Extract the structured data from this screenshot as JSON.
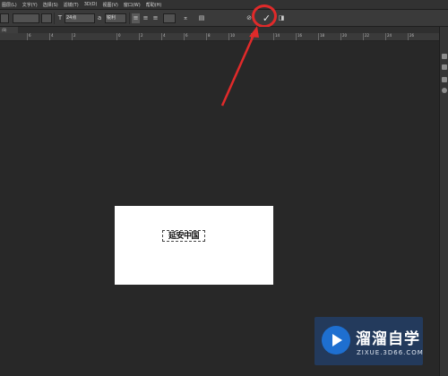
{
  "menubar": {
    "items": [
      "图层(L)",
      "文字(Y)",
      "选择(S)",
      "滤镜(T)",
      "3D(D)",
      "视图(V)",
      "窗口(W)",
      "帮助(H)"
    ]
  },
  "options": {
    "font_size": "24点",
    "antialias": "锐利",
    "icons": [
      "text-orientation-icon",
      "align-left-icon",
      "align-center-icon",
      "align-right-icon",
      "warp-text-icon",
      "character-panel-icon",
      "cancel-icon",
      "commit-icon",
      "3d-icon"
    ],
    "commit_glyph": "✓",
    "cancel_glyph": "⊘"
  },
  "tabs": [
    "/8)"
  ],
  "ruler": {
    "ticks": [
      "6",
      "4",
      "2",
      "0",
      "2",
      "4",
      "6",
      "8",
      "10",
      "12",
      "14",
      "16",
      "18",
      "20",
      "22",
      "24",
      "26"
    ]
  },
  "canvas": {
    "text": "延安中国"
  },
  "watermark": {
    "title": "溜溜自学",
    "url": "ZIXUE.3D66.COM"
  },
  "colors": {
    "highlight": "#e02a2a",
    "app_background": "#282828"
  }
}
